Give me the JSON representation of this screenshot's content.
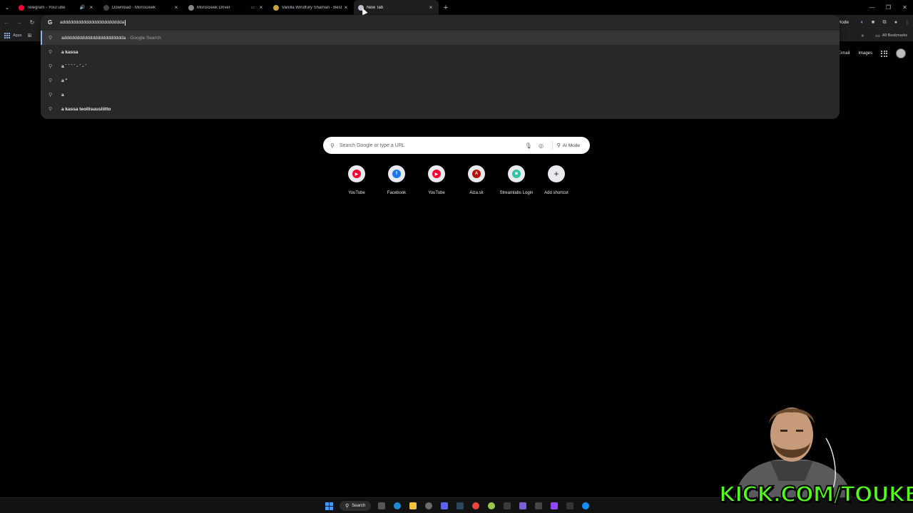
{
  "tabs": [
    {
      "title": "Telegram - YouTube",
      "fav_color": "#ff0033",
      "extra": "🔊"
    },
    {
      "title": "Download - MonsGeek",
      "fav_color": "#444444",
      "extra": ""
    },
    {
      "title": "MonsGeek Driver",
      "fav_color": "#888888",
      "extra": "▭"
    },
    {
      "title": "Vanilla Windfury Shaman - Best",
      "fav_color": "#c8a13b",
      "extra": ""
    },
    {
      "title": "New Tab",
      "fav_color": "#bdc1c6",
      "extra": "",
      "active": true
    }
  ],
  "toolbar": {
    "ai_mode_label": "AI Mode"
  },
  "bookmarks": {
    "apps_label": "Apps",
    "all_bookmarks_label": "All Bookmarks"
  },
  "omnibox": {
    "query": "addddddddddddddddddddddda",
    "suggestions": [
      {
        "main": "addddddddddddddddddddddda",
        "sub": "- Google Search",
        "selected": true
      },
      {
        "main": "a kassa",
        "sub": ""
      },
      {
        "main": "a ` ` ` ` - ` - `",
        "sub": ""
      },
      {
        "main": "a \"",
        "sub": ""
      },
      {
        "main": "a",
        "sub": ""
      },
      {
        "main": "a kassa teollisuusliitto",
        "sub": ""
      }
    ]
  },
  "ntp": {
    "gmail_label": "Gmail",
    "images_label": "Images",
    "search_placeholder": "Search Google or type a URL",
    "ai_mode_label": "AI Mode",
    "shortcuts": [
      {
        "label": "YouTube",
        "color": "#ff0033",
        "glyph": "▶"
      },
      {
        "label": "Facebook",
        "color": "#1877f2",
        "glyph": "f"
      },
      {
        "label": "YouTube",
        "color": "#ff0033",
        "glyph": "▶"
      },
      {
        "label": "Alza.sk",
        "color": "#b5120e",
        "glyph": "A"
      },
      {
        "label": "Streamlabs Login",
        "color": "#31c3a2",
        "glyph": "◙"
      },
      {
        "label": "Add shortcut",
        "color": "",
        "glyph": "+"
      }
    ]
  },
  "taskbar": {
    "search_label": "Search"
  },
  "watermark": "KICK.COM/TOUKEN"
}
